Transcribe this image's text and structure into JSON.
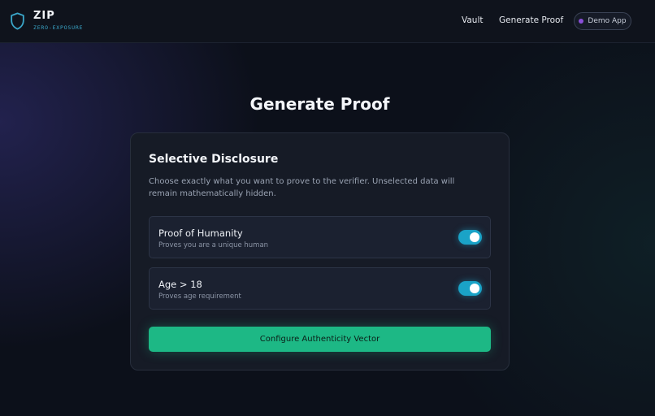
{
  "header": {
    "brand_title": "ZIP",
    "brand_subtitle": "ZERO-EXPOSURE",
    "logo_icon": "shield-icon",
    "nav": [
      {
        "label": "Vault"
      },
      {
        "label": "Generate Proof"
      }
    ],
    "demo_pill_label": "Demo App",
    "demo_dot_color": "#8a4fd8"
  },
  "main": {
    "page_title": "Generate Proof",
    "card": {
      "title": "Selective Disclosure",
      "description": "Choose exactly what you want to prove to the verifier. Unselected data will remain mathematically hidden.",
      "options": [
        {
          "title": "Proof of Humanity",
          "subtitle": "Proves you are a unique human",
          "enabled": true
        },
        {
          "title": "Age > 18",
          "subtitle": "Proves age requirement",
          "enabled": true
        }
      ],
      "cta_label": "Configure Authenticity Vector"
    }
  },
  "colors": {
    "accent_toggle": "#1aa3c7",
    "accent_cta": "#1db885",
    "brand_subtitle": "#3aa6c9",
    "background": "#0c101a"
  }
}
